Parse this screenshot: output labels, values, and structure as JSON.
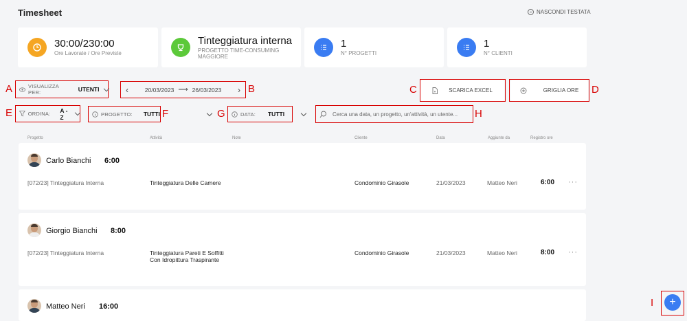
{
  "header": {
    "title": "Timesheet",
    "hide_header_label": "NASCONDI TESTATA"
  },
  "cards": [
    {
      "big": "30:00/230:00",
      "small": "Ore Lavorate / Ore Previste",
      "icon": "clock-icon",
      "color": "#f5a623"
    },
    {
      "big": "Tinteggiatura interna",
      "small": "PROGETTO TIME-CONSUMING MAGGIORE",
      "icon": "trophy-icon",
      "color": "#5cc93a"
    },
    {
      "big": "1",
      "small": "N° PROGETTI",
      "icon": "list-icon",
      "color": "#3a7cf2"
    },
    {
      "big": "1",
      "small": "N° CLIENTI",
      "icon": "list-icon",
      "color": "#3a7cf2"
    }
  ],
  "controls": {
    "view_by_label": "VISUALIZZA PER:",
    "view_by_value": "UTENTI",
    "date_from": "20/03/2023",
    "date_to": "26/03/2023",
    "excel_label": "SCARICA EXCEL",
    "grid_label": "GRIGLIA ORE",
    "order_label": "ORDINA:",
    "order_value": "A -Z",
    "project_label": "PROGETTO:",
    "project_value": "TUTTI",
    "date_label": "DATA:",
    "date_value": "TUTTI",
    "search_placeholder": "Cerca una data, un progetto, un'attività, un utente..."
  },
  "annotations": {
    "A": "A",
    "B": "B",
    "C": "C",
    "D": "D",
    "E": "E",
    "F": "F",
    "G": "G",
    "H": "H",
    "I": "I"
  },
  "columns": [
    "Progetto",
    "Attività",
    "Note",
    "Cliente",
    "Data",
    "Aggiunte da",
    "Registro ore"
  ],
  "entries": [
    {
      "user": "Carlo Bianchi",
      "total": "6:00",
      "rows": [
        {
          "project": "[072/23] Tinteggiatura Interna",
          "activity": "Tinteggiatura Delle Camere",
          "client": "Condominio Girasole",
          "date": "21/03/2023",
          "added_by": "Matteo Neri",
          "hours": "6:00"
        }
      ]
    },
    {
      "user": "Giorgio Bianchi",
      "total": "8:00",
      "rows": [
        {
          "project": "[072/23] Tinteggiatura Interna",
          "activity": "Tinteggiatura Pareti E Soffitti Con Idropittura Traspirante",
          "client": "Condominio Girasole",
          "date": "21/03/2023",
          "added_by": "Matteo Neri",
          "hours": "8:00"
        }
      ]
    },
    {
      "user": "Matteo Neri",
      "total": "16:00",
      "rows": []
    }
  ],
  "row_menu": "···",
  "fab_label": "+"
}
